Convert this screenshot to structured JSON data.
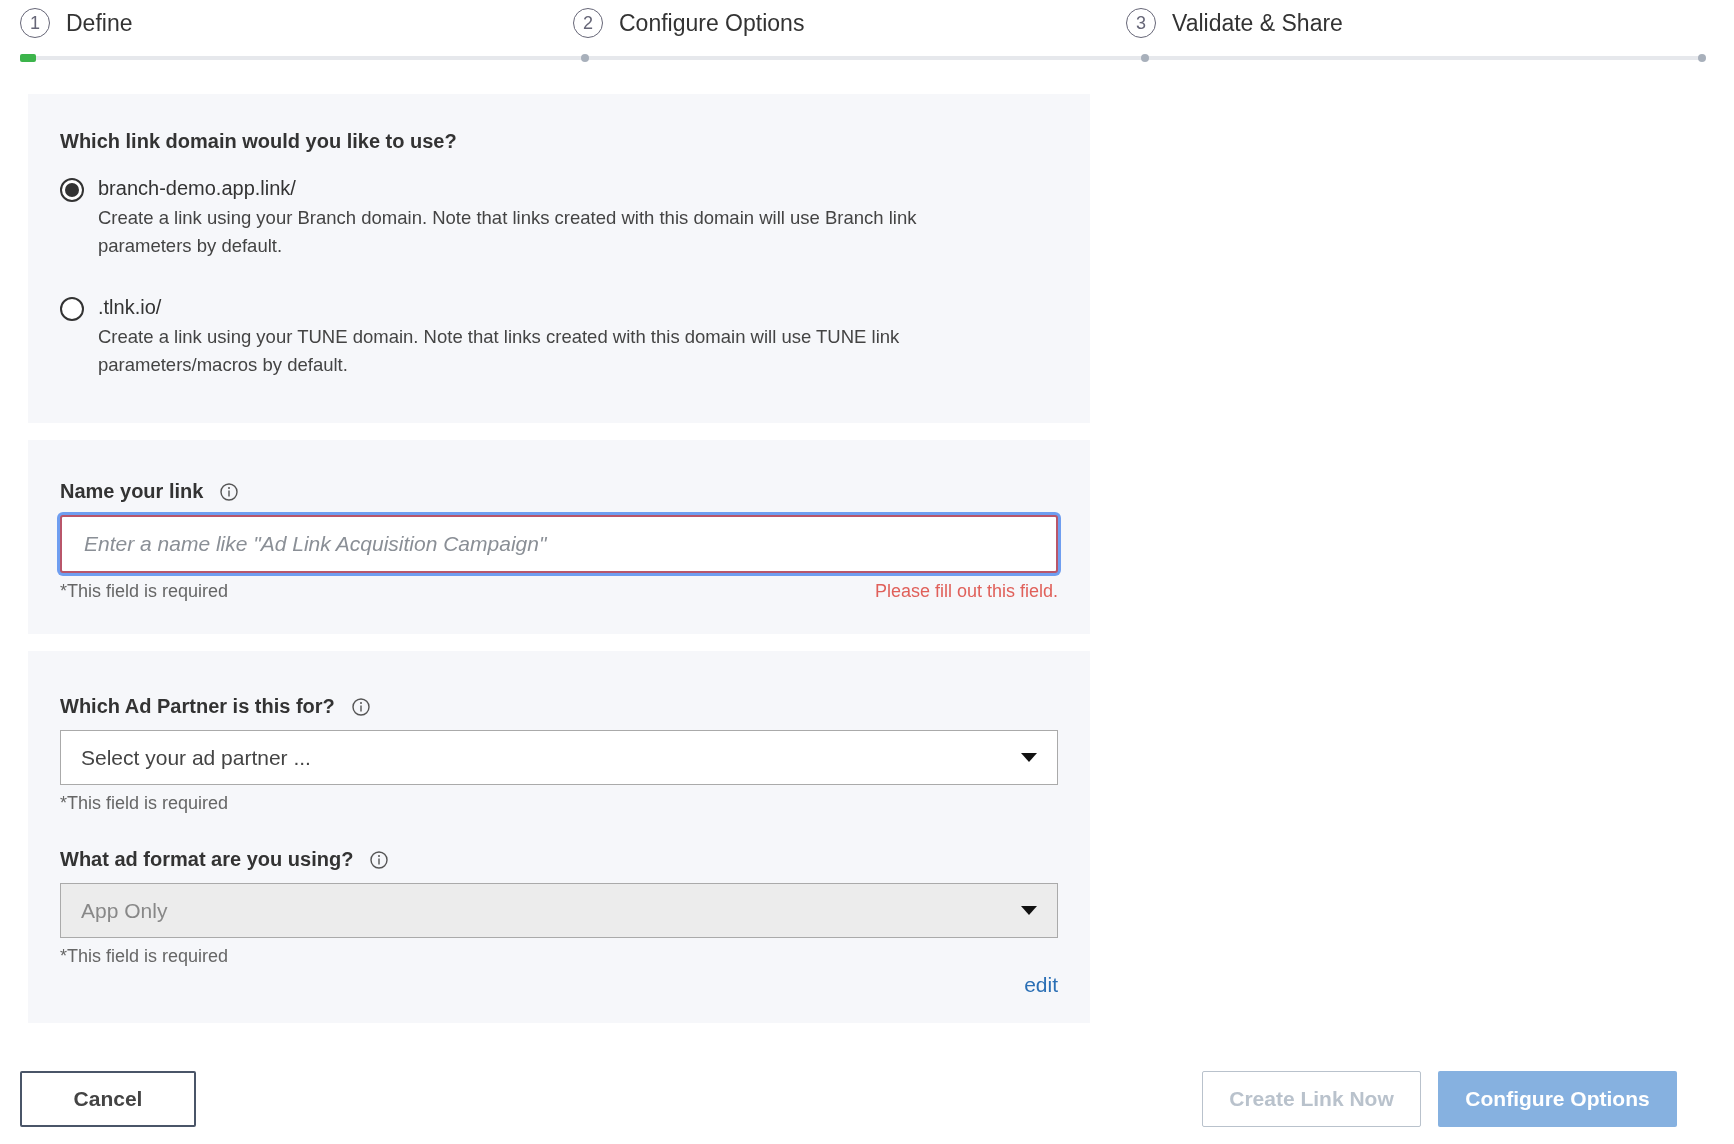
{
  "steps": [
    {
      "number": "1",
      "label": "Define",
      "selected": true
    },
    {
      "number": "2",
      "label": "Configure Options",
      "selected": false
    },
    {
      "number": "3",
      "label": "Validate & Share",
      "selected": false
    }
  ],
  "domain": {
    "question": "Which link domain would you like to use?",
    "options": [
      {
        "label": "branch-demo.app.link/",
        "description": "Create a link using your Branch domain. Note that links created with this domain will use Branch link parameters by default.",
        "selected": true
      },
      {
        "label": ".tlnk.io/",
        "description": "Create a link using your TUNE domain. Note that links created with this domain will use TUNE link parameters/macros by default.",
        "selected": false
      }
    ]
  },
  "name_field": {
    "label": "Name your link",
    "placeholder": "Enter a name like \"Ad Link Acquisition Campaign\"",
    "hint": "*This field is required",
    "error": "Please fill out this field."
  },
  "selects": [
    {
      "label": "Which Ad Partner is this for?",
      "value": "Select your ad partner ...",
      "hint": "*This field is required",
      "disabled": false
    },
    {
      "label": "What ad format are you using?",
      "value": "App Only",
      "hint": "*This field is required",
      "disabled": true
    }
  ],
  "edit_link": "edit",
  "buttons": [
    {
      "label": "Cancel",
      "kind": "outline"
    },
    {
      "label": "Create Link Now",
      "kind": "muted"
    },
    {
      "label": "Configure Options",
      "kind": "primary"
    }
  ]
}
